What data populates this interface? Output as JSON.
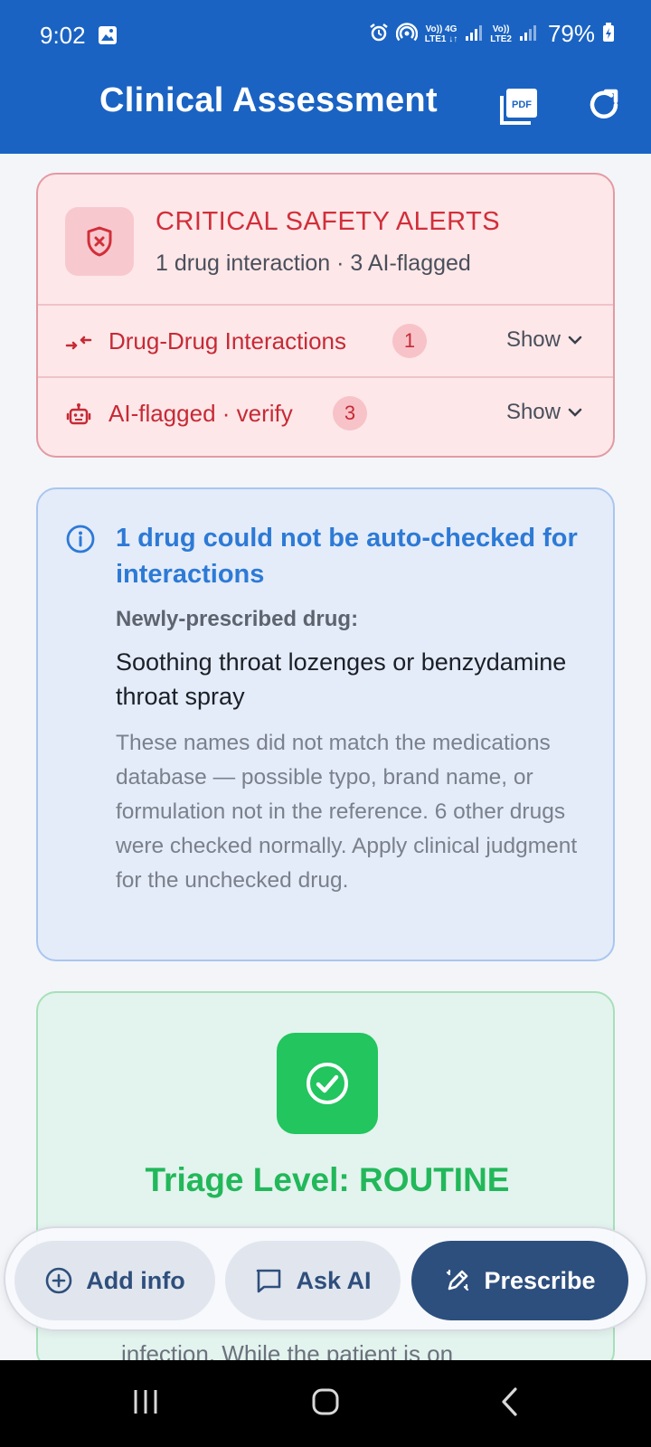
{
  "status_bar": {
    "time": "9:02",
    "net1_top": "Vo)) 4G",
    "net1_bottom": "LTE1 ↓↑",
    "net2_top": "Vo))",
    "net2_bottom": "LTE2",
    "battery": "79%"
  },
  "app_bar": {
    "title": "Clinical Assessment",
    "pdf_label": "PDF"
  },
  "alerts": {
    "title": "CRITICAL SAFETY ALERTS",
    "subtitle": "1 drug interaction · 3 AI-flagged",
    "rows": [
      {
        "label": "Drug-Drug Interactions",
        "count": "1",
        "toggle": "Show"
      },
      {
        "label": "AI-flagged · verify",
        "count": "3",
        "toggle": "Show"
      }
    ]
  },
  "info": {
    "title": "1 drug could not be auto-checked for interactions",
    "label": "Newly-prescribed drug:",
    "drug": "Soothing throat lozenges or benzydamine throat spray",
    "description": "These names did not match the medications database — possible typo, brand name, or formulation not in the reference. 6 other drugs were checked normally. Apply clinical judgment for the unchecked drug."
  },
  "triage": {
    "title": "Triage Level: ROUTINE",
    "body_partial": "infection. While the patient is on"
  },
  "actions": {
    "add_info": "Add info",
    "ask_ai": "Ask AI",
    "prescribe": "Prescribe"
  },
  "colors": {
    "app_bar": "#1a63c3",
    "alert_red": "#d12f3a",
    "info_blue": "#2d7ad6",
    "success_green": "#22c55e",
    "prescribe_bg": "#2d4f7e"
  }
}
